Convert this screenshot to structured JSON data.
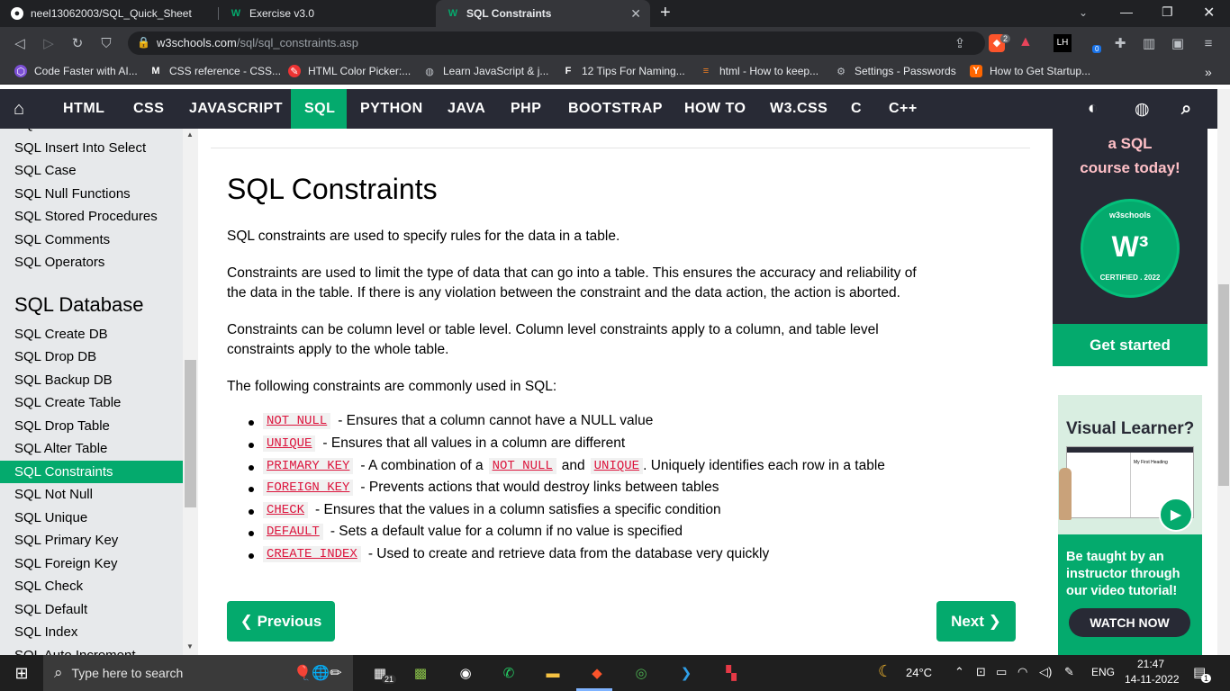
{
  "browser": {
    "tabs": [
      {
        "title": "neel13062003/SQL_Quick_Sheet",
        "icon": "github-icon"
      },
      {
        "title": "Exercise v3.0",
        "icon": "w3schools-icon"
      },
      {
        "title": "SQL Constraints",
        "icon": "w3schools-icon",
        "active": true
      }
    ],
    "new_tab": "+",
    "url_domain": "w3schools.com",
    "url_path": "/sql/sql_constraints.asp",
    "brave_badge": "2",
    "ext_badge": "0",
    "profile": "LH",
    "bookmarks": [
      "Code Faster with AI...",
      "CSS reference - CSS...",
      "HTML Color Picker:...",
      "Learn JavaScript & j...",
      "12 Tips For Naming...",
      "html - How to keep...",
      "Settings - Passwords",
      "How to Get Startup..."
    ],
    "bookmarks_more": "»"
  },
  "nav": {
    "items": [
      "HTML",
      "CSS",
      "JAVASCRIPT",
      "SQL",
      "PYTHON",
      "JAVA",
      "PHP",
      "BOOTSTRAP",
      "HOW TO",
      "W3.CSS",
      "C",
      "C++"
    ],
    "active": "SQL"
  },
  "sidebar": {
    "items_top": [
      "SQL Insert Into Select",
      "SQL Case",
      "SQL Null Functions",
      "SQL Stored Procedures",
      "SQL Comments",
      "SQL Operators"
    ],
    "section_heading": "SQL Database",
    "items_db": [
      "SQL Create DB",
      "SQL Drop DB",
      "SQL Backup DB",
      "SQL Create Table",
      "SQL Drop Table",
      "SQL Alter Table",
      "SQL Constraints",
      "SQL Not Null",
      "SQL Unique",
      "SQL Primary Key",
      "SQL Foreign Key",
      "SQL Check",
      "SQL Default",
      "SQL Index",
      "SQL Auto Increment"
    ],
    "active": "SQL Constraints"
  },
  "main": {
    "title": "SQL Constraints",
    "p1": "SQL constraints are used to specify rules for the data in a table.",
    "p2_line1": "Constraints are used to limit the type of data that can go into a table. This ensures the accuracy and reliability of",
    "p2_line2": "the data in the table. If there is any violation between the constraint and the data action, the action is aborted.",
    "p3_line1": "Constraints can be column level or table level. Column level constraints apply to a column, and table level",
    "p3_line2": "constraints apply to the whole table.",
    "p4": "The following constraints are commonly used in SQL:",
    "constraints": [
      {
        "code": "NOT NULL",
        "text": "- Ensures that a column cannot have a NULL value"
      },
      {
        "code": "UNIQUE",
        "text": "- Ensures that all values in a column are different"
      },
      {
        "code": "PRIMARY KEY",
        "text": "- A combination of a",
        "code2": "NOT NULL",
        "mid": "and",
        "code3": "UNIQUE",
        "tail": ". Uniquely identifies each row in a table"
      },
      {
        "code": "FOREIGN KEY",
        "text": "- Prevents actions that would destroy links between tables"
      },
      {
        "code": "CHECK",
        "text": "- Ensures that the values in a column satisfies a specific condition"
      },
      {
        "code": "DEFAULT",
        "text": "- Sets a default value for a column if no value is specified"
      },
      {
        "code": "CREATE INDEX",
        "text": "- Used to create and retrieve data from the database very quickly"
      }
    ],
    "prev_label": "❮ Previous",
    "next_label": "Next ❯"
  },
  "ads": {
    "promo_line1": "a SQL",
    "promo_line2": "course today!",
    "badge_top": "w3schools",
    "badge_bottom": "CERTIFIED . 2022",
    "get_started": "Get started",
    "visual_title": "Visual Learner?",
    "visual_text": "Be taught by an instructor through our video tutorial!",
    "watch_now": "WATCH NOW"
  },
  "taskbar": {
    "search_placeholder": "Type here to search",
    "weather": "24°C",
    "lang": "ENG",
    "time": "21:47",
    "date": "14-11-2022",
    "mail_badge": "21",
    "notif_count": "1"
  },
  "colors": {
    "w3_green": "#04aa6d",
    "nav_dark": "#282a35",
    "code_red": "#dc143c",
    "chrome_dark": "#202124"
  }
}
